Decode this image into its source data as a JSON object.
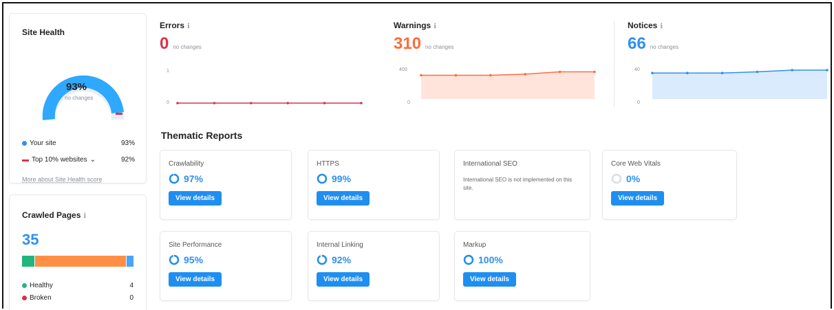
{
  "site_health": {
    "title": "Site Health",
    "score": "93%",
    "score_note": "no changes",
    "legend": [
      {
        "label": "Your site",
        "value": "93%",
        "color": "#2f8ff2"
      },
      {
        "label": "Top 10% websites",
        "value": "92%",
        "color": "#d6334c"
      }
    ],
    "link": "More about Site Health score"
  },
  "crawled_pages": {
    "title": "Crawled Pages",
    "count": "35",
    "bar": [
      {
        "color": "#22b67c",
        "fraction": 0.11
      },
      {
        "color": "#ff8f45",
        "fraction": 0.83
      },
      {
        "color": "#49a3f7",
        "fraction": 0.06
      }
    ],
    "legend": [
      {
        "label": "Healthy",
        "value": "4",
        "color": "#22b67c"
      },
      {
        "label": "Broken",
        "value": "0",
        "color": "#d6334c"
      }
    ]
  },
  "metrics": [
    {
      "title": "Errors",
      "value": "0",
      "note": "no changes",
      "color": "#d6334c",
      "y_top": "1",
      "y_bottom": "0",
      "trend": [
        0,
        0,
        0,
        0,
        0,
        0
      ]
    },
    {
      "title": "Warnings",
      "value": "310",
      "note": "no changes",
      "color": "#ff6b3d",
      "y_top": "400",
      "y_bottom": "0",
      "trend": [
        0.82,
        0.82,
        0.82,
        0.86,
        0.94,
        0.94
      ]
    },
    {
      "title": "Notices",
      "value": "66",
      "note": "no changes",
      "color": "#2f8ff2",
      "y_top": "40",
      "y_bottom": "0",
      "trend": [
        0.9,
        0.9,
        0.9,
        0.94,
        1.0,
        1.0
      ]
    }
  ],
  "thematic": {
    "title": "Thematic Reports",
    "view_label": "View details",
    "reports": [
      {
        "name": "Crawlability",
        "pct": "97%",
        "value": 0.97
      },
      {
        "name": "HTTPS",
        "pct": "99%",
        "value": 0.99
      },
      {
        "name": "International SEO",
        "note": "International SEO is not implemented on this site."
      },
      {
        "name": "Core Web Vitals",
        "pct": "0%",
        "value": 0.0
      },
      {
        "name": "Site Performance",
        "pct": "95%",
        "value": 0.95
      },
      {
        "name": "Internal Linking",
        "pct": "92%",
        "value": 0.92
      },
      {
        "name": "Markup",
        "pct": "100%",
        "value": 1.0
      }
    ]
  }
}
